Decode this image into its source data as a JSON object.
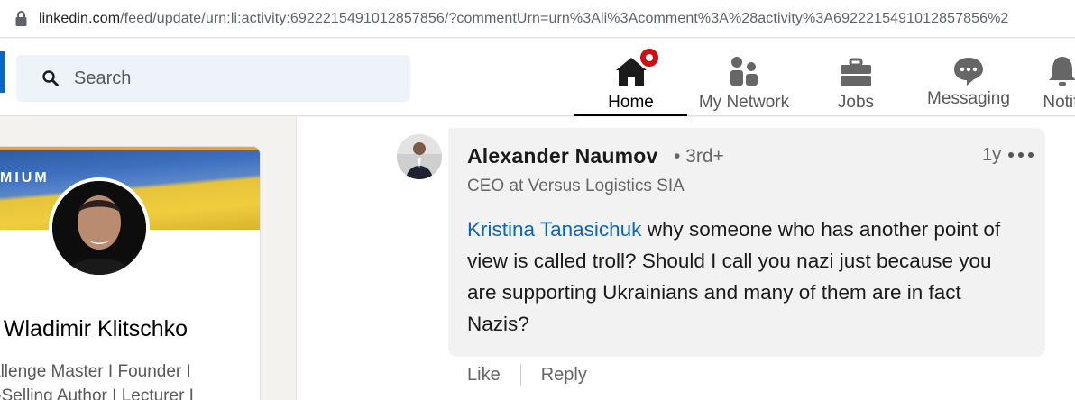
{
  "browser": {
    "url_domain": "linkedin.com",
    "url_path": "/feed/update/urn:li:activity:6922215491012857856/?commentUrn=urn%3Ali%3Acomment%3A%28activity%3A6922215491012857856%2"
  },
  "nav": {
    "search_placeholder": "Search",
    "items": [
      {
        "label": "Home",
        "icon": "home-icon",
        "active": true
      },
      {
        "label": "My Network",
        "icon": "network-icon"
      },
      {
        "label": "Jobs",
        "icon": "briefcase-icon"
      },
      {
        "label": "Messaging",
        "icon": "messaging-icon"
      },
      {
        "label": "Notifi",
        "icon": "bell-icon"
      }
    ]
  },
  "profile_card": {
    "banner_text": "MIUM",
    "name": ". Wladimir Klitschko",
    "headline_line1": "allenge Master I Founder I",
    "headline_line2": "t-Selling Author I Lecturer I"
  },
  "comment": {
    "author": "Alexander Naumov",
    "degree": "• 3rd+",
    "time": "1y",
    "headline": "CEO at Versus Logistics SIA",
    "mention": "Kristina Tanasichuk",
    "text": " why someone who has another point of view is called troll? Should I call you nazi just because you are supporting Ukrainians and many of them are in fact Nazis?",
    "actions": {
      "like": "Like",
      "reply": "Reply"
    }
  },
  "colors": {
    "brand_blue": "#0a66c2",
    "notification_red": "#cc1016",
    "bubble_bg": "#f2f2f2"
  }
}
